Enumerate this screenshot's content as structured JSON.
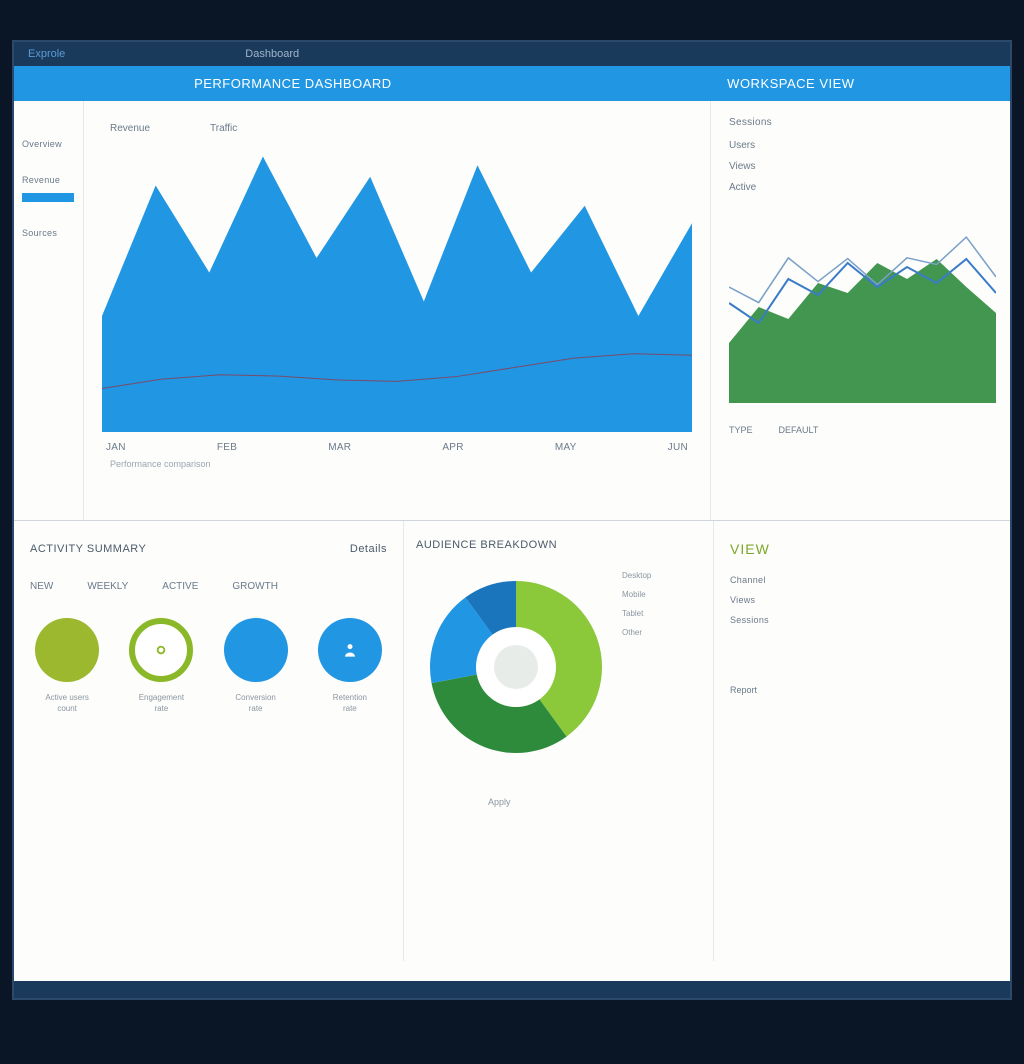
{
  "titlebar": {
    "brand": "Exprole",
    "sub": "Dashboard"
  },
  "header": {
    "left": "PERFORMANCE DASHBOARD",
    "right": "WORKSPACE VIEW"
  },
  "sidebar": {
    "items": [
      "Overview",
      "Revenue",
      "Sources"
    ]
  },
  "mainChart": {
    "topLabels": [
      "Revenue",
      "Traffic"
    ],
    "xaxis": [
      "JAN",
      "FEB",
      "MAR",
      "APR",
      "MAY",
      "JUN"
    ],
    "footnote": "Performance comparison"
  },
  "rightTop": {
    "title": "Sessions",
    "labels": [
      "Users",
      "Views"
    ],
    "tag": "Active",
    "foot": [
      "TYPE",
      "DEFAULT"
    ]
  },
  "metrics": {
    "title": "ACTIVITY SUMMARY",
    "dropdown": "Details",
    "subs": [
      "NEW",
      "WEEKLY",
      "ACTIVE",
      "GROWTH"
    ],
    "circles": [
      {
        "label": "Active users",
        "sub": "count"
      },
      {
        "label": "Engagement",
        "sub": "rate"
      },
      {
        "label": "Conversion",
        "sub": "rate"
      },
      {
        "label": "Retention",
        "sub": "rate"
      }
    ]
  },
  "donut": {
    "title": "AUDIENCE BREAKDOWN",
    "legend": [
      "Desktop",
      "Mobile",
      "Tablet",
      "Other"
    ],
    "foot": "Apply"
  },
  "rightPanel": {
    "title": "VIEW",
    "lines": [
      "Channel",
      "Views",
      "Sessions"
    ],
    "foot": "Report"
  },
  "colors": {
    "primary": "#2196e3",
    "green": "#2e8b3c",
    "lime": "#8bc83a",
    "olive": "#9bb82f"
  },
  "chart_data": [
    {
      "type": "area",
      "title": "Main traffic",
      "categories": [
        "JAN",
        "FEB",
        "MAR",
        "APR",
        "MAY",
        "JUN"
      ],
      "values": [
        40,
        85,
        55,
        95,
        60,
        88,
        45,
        92,
        55,
        78,
        40,
        72
      ],
      "ylim": [
        0,
        100
      ]
    },
    {
      "type": "area",
      "title": "Sessions mini",
      "x": [
        0,
        1,
        2,
        3,
        4,
        5,
        6,
        7,
        8,
        9
      ],
      "series": [
        {
          "name": "green",
          "values": [
            30,
            48,
            42,
            60,
            55,
            70,
            62,
            72,
            58,
            45
          ]
        },
        {
          "name": "blue",
          "values": [
            50,
            40,
            62,
            54,
            70,
            58,
            68,
            60,
            72,
            55
          ]
        }
      ],
      "ylim": [
        0,
        100
      ]
    },
    {
      "type": "pie",
      "title": "Audience breakdown",
      "categories": [
        "Desktop",
        "Mobile",
        "Tablet",
        "Other"
      ],
      "values": [
        40,
        32,
        18,
        10
      ]
    }
  ]
}
